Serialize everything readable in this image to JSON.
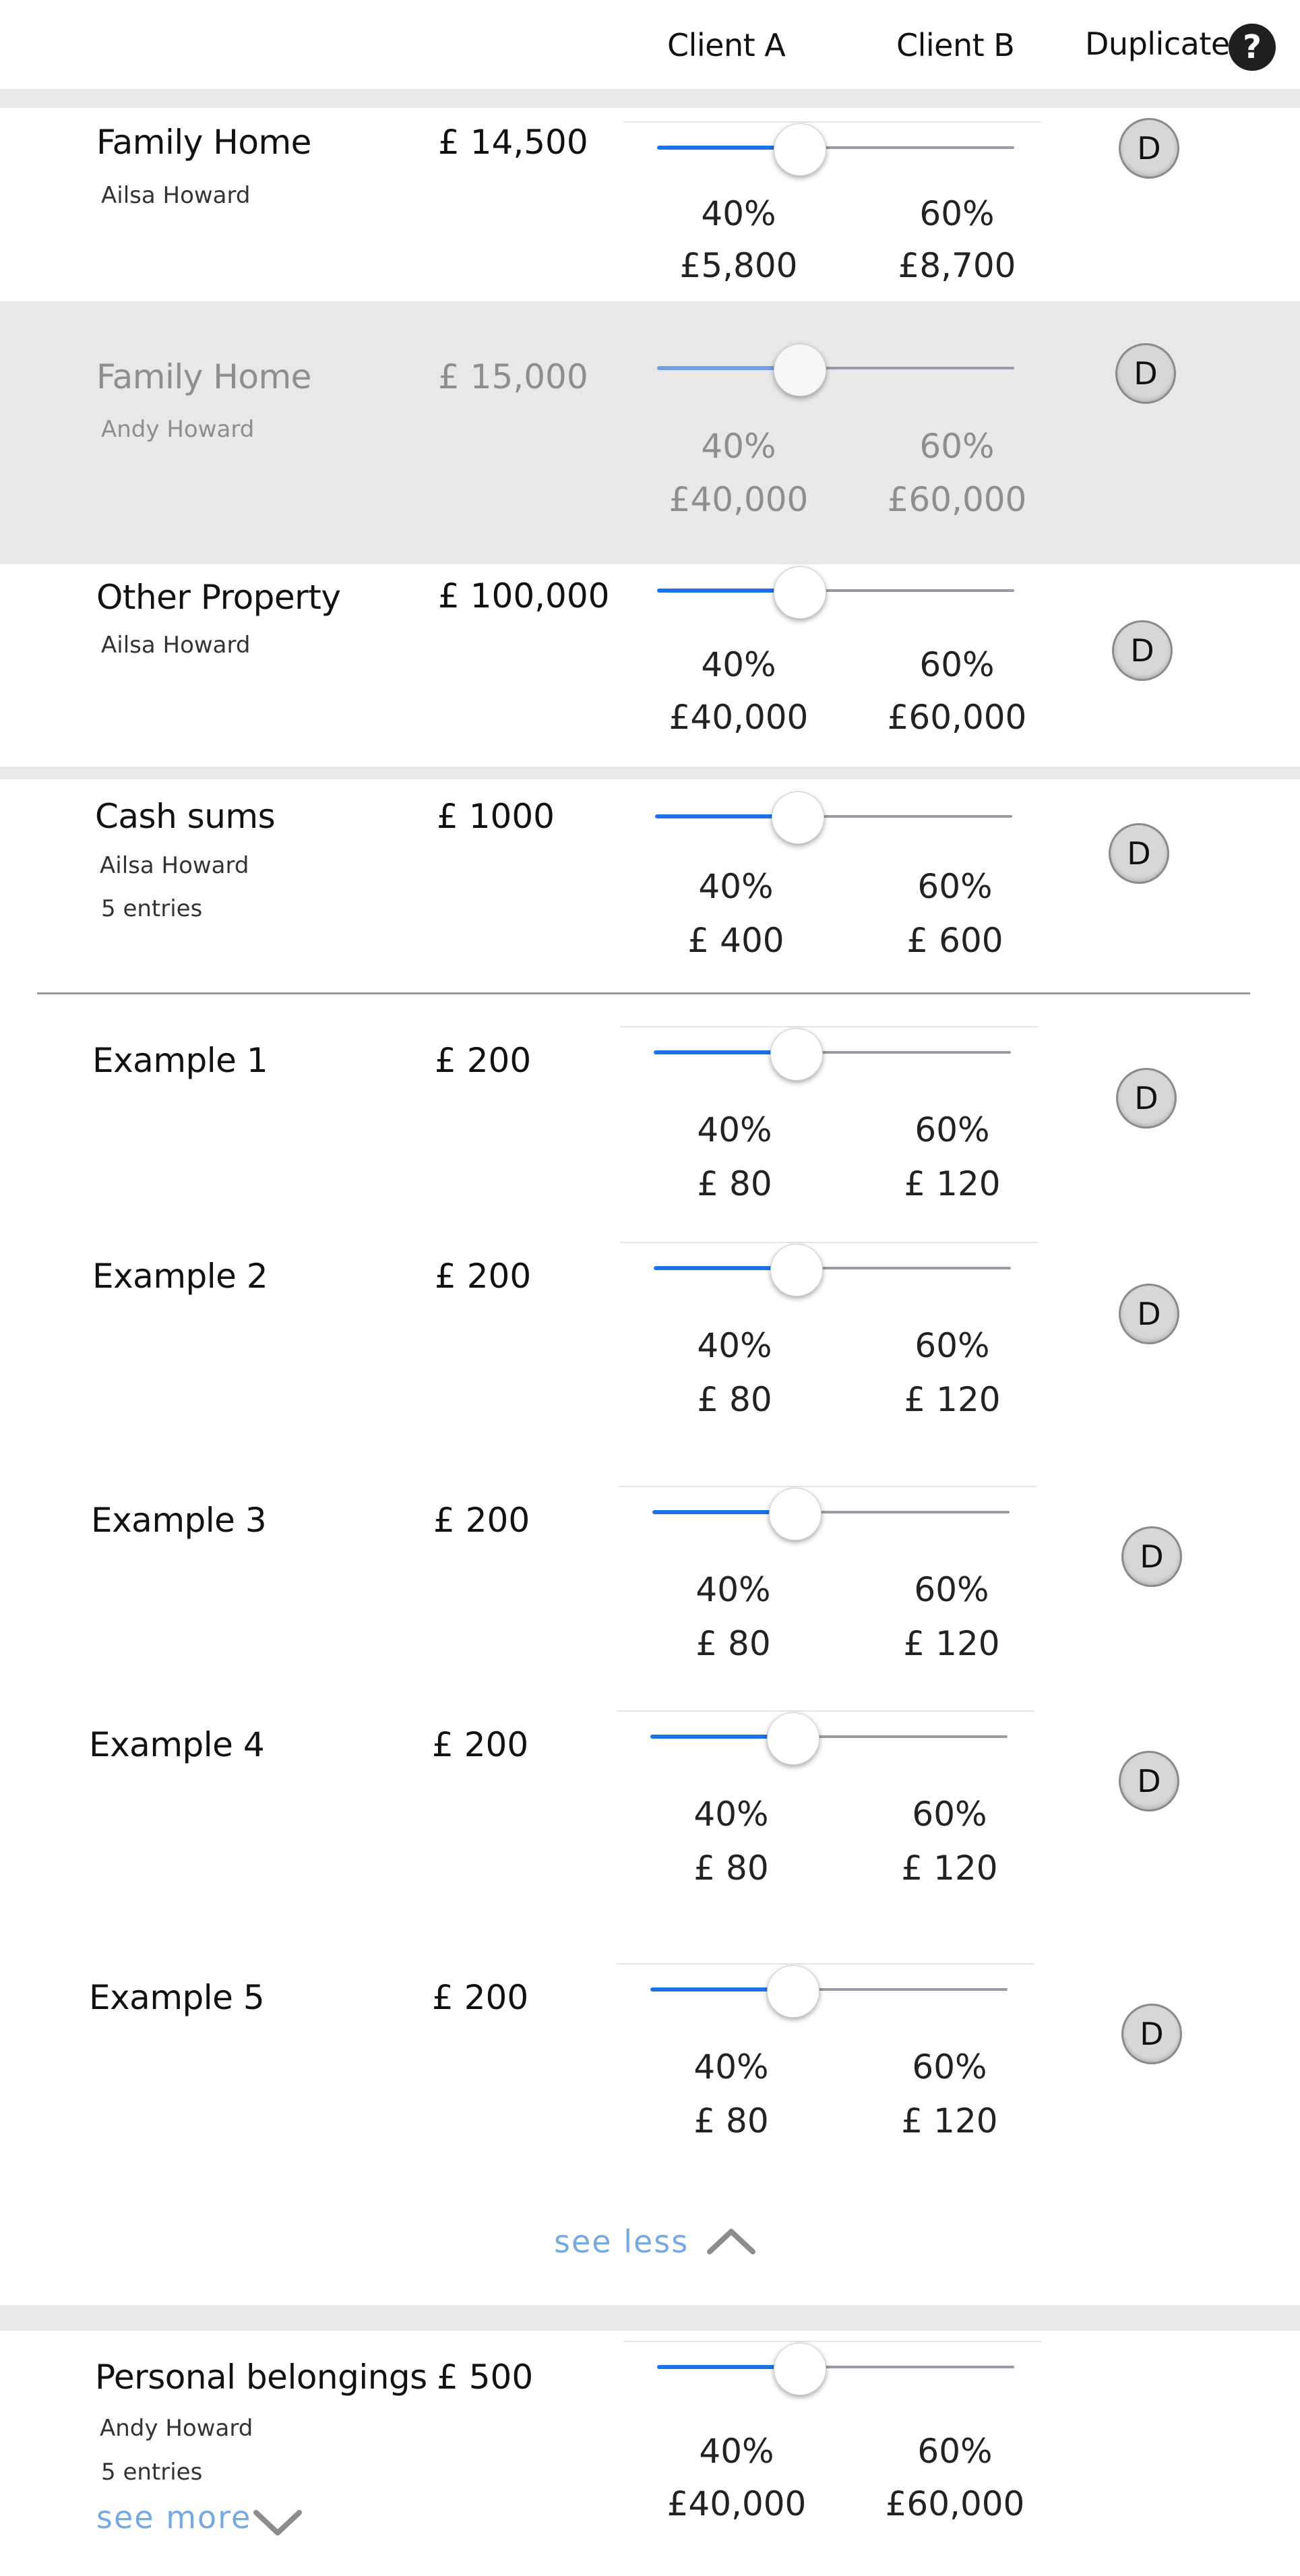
{
  "header": {
    "client_a": "Client A",
    "client_b": "Client B",
    "duplicate": "Duplicate",
    "help_glyph": "?"
  },
  "rows": [
    {
      "title": "Family Home",
      "owner": "Ailsa Howard",
      "amount": "£ 14,500",
      "slider_fraction": 0.4,
      "pct_a": "40%",
      "pct_b": "60%",
      "val_a": "£5,800",
      "val_b": "£8,700",
      "dup": "D"
    },
    {
      "title": "Family Home",
      "owner": "Andy Howard",
      "amount": "£ 15,000",
      "slider_fraction": 0.4,
      "pct_a": "40%",
      "pct_b": "60%",
      "val_a": "£40,000",
      "val_b": "£60,000",
      "dup": "D"
    },
    {
      "title": "Other Property",
      "owner": "Ailsa Howard",
      "amount": "£ 100,000",
      "slider_fraction": 0.4,
      "pct_a": "40%",
      "pct_b": "60%",
      "val_a": "£40,000",
      "val_b": "£60,000",
      "dup": "D"
    },
    {
      "title": "Cash sums",
      "owner": "Ailsa Howard",
      "entries": "5 entries",
      "amount": "£ 1000",
      "slider_fraction": 0.4,
      "pct_a": "40%",
      "pct_b": "60%",
      "val_a": "£ 400",
      "val_b": "£ 600",
      "dup": "D"
    }
  ],
  "examples": [
    {
      "title": "Example 1",
      "amount": "£ 200",
      "slider_fraction": 0.4,
      "pct_a": "40%",
      "pct_b": "60%",
      "val_a": "£ 80",
      "val_b": "£ 120",
      "dup": "D"
    },
    {
      "title": "Example 2",
      "amount": "£ 200",
      "slider_fraction": 0.4,
      "pct_a": "40%",
      "pct_b": "60%",
      "val_a": "£ 80",
      "val_b": "£ 120",
      "dup": "D"
    },
    {
      "title": "Example 3",
      "amount": "£ 200",
      "slider_fraction": 0.4,
      "pct_a": "40%",
      "pct_b": "60%",
      "val_a": "£ 80",
      "val_b": "£ 120",
      "dup": "D"
    },
    {
      "title": "Example 4",
      "amount": "£ 200",
      "slider_fraction": 0.4,
      "pct_a": "40%",
      "pct_b": "60%",
      "val_a": "£ 80",
      "val_b": "£ 120",
      "dup": "D"
    },
    {
      "title": "Example 5",
      "amount": "£ 200",
      "slider_fraction": 0.4,
      "pct_a": "40%",
      "pct_b": "60%",
      "val_a": "£ 80",
      "val_b": "£ 120",
      "dup": "D"
    }
  ],
  "see_less": "see less",
  "personal": {
    "title": "Personal belongings",
    "owner": "Andy Howard",
    "entries": "5 entries",
    "amount": "£ 500",
    "slider_fraction": 0.4,
    "pct_a": "40%",
    "pct_b": "60%",
    "val_a": "£40,000",
    "val_b": "£60,000"
  },
  "see_more": "see more",
  "colors": {
    "accent": "#1a73e8",
    "link": "#76a9e0",
    "muted_bg": "#e8e8e8"
  }
}
